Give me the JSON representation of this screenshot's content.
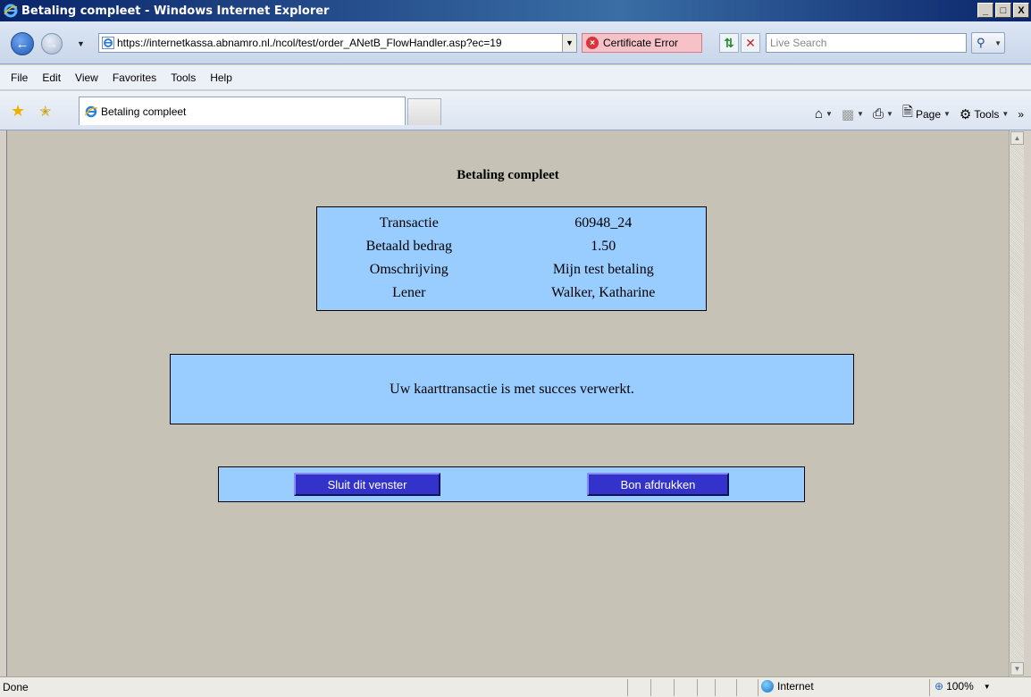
{
  "window": {
    "title": "Betaling compleet - Windows Internet Explorer",
    "min": "_",
    "max": "□",
    "close": "X"
  },
  "address": {
    "url": "https://internetkassa.abnamro.nl./ncol/test/order_ANetB_FlowHandler.asp?ec=19",
    "cert_error": "Certificate Error",
    "search_placeholder": "Live Search"
  },
  "menu": [
    "File",
    "Edit",
    "View",
    "Favorites",
    "Tools",
    "Help"
  ],
  "tab": {
    "title": "Betaling compleet"
  },
  "commandbar": {
    "page": "Page",
    "tools": "Tools"
  },
  "page": {
    "heading": "Betaling compleet",
    "rows": [
      {
        "label": "Transactie",
        "value": "60948_24"
      },
      {
        "label": "Betaald bedrag",
        "value": "1.50"
      },
      {
        "label": "Omschrijving",
        "value": "Mijn test betaling"
      },
      {
        "label": "Lener",
        "value": "Walker, Katharine"
      }
    ],
    "message": "Uw kaarttransactie is met succes verwerkt.",
    "close_button": "Sluit dit venster",
    "print_button": "Bon afdrukken"
  },
  "status": {
    "text": "Done",
    "zone": "Internet",
    "zoom": "100%"
  }
}
